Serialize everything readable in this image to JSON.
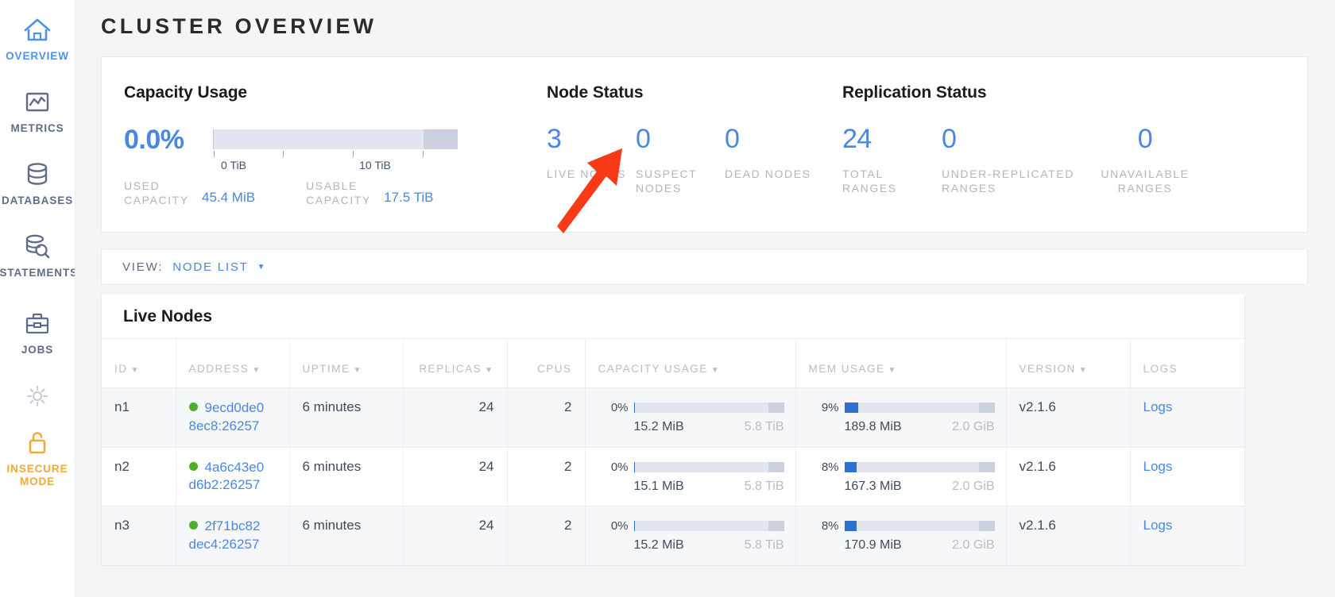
{
  "sidebar": {
    "items": [
      {
        "label": "OVERVIEW",
        "icon": "home-icon",
        "state": "active"
      },
      {
        "label": "METRICS",
        "icon": "chart-icon",
        "state": "normal"
      },
      {
        "label": "DATABASES",
        "icon": "database-icon",
        "state": "normal"
      },
      {
        "label": "STATEMENTS",
        "icon": "database-search-icon",
        "state": "normal"
      },
      {
        "label": "JOBS",
        "icon": "briefcase-icon",
        "state": "normal"
      },
      {
        "label": "",
        "icon": "gear-icon",
        "state": "normal"
      },
      {
        "label": "INSECURE MODE",
        "icon": "unlocked-padlock-icon",
        "state": "insecure"
      }
    ]
  },
  "page": {
    "title": "CLUSTER OVERVIEW"
  },
  "capacity": {
    "title": "Capacity Usage",
    "percent": "0.0%",
    "percent_value": 0.0,
    "ticks": [
      {
        "label": "0 TiB",
        "pos": 0
      },
      {
        "label": "",
        "pos": 28.6
      },
      {
        "label": "10 TiB",
        "pos": 57.1
      },
      {
        "label": "",
        "pos": 85.7
      }
    ],
    "used_label": "USED CAPACITY",
    "used_value": "45.4 MiB",
    "usable_label": "USABLE CAPACITY",
    "usable_value": "17.5 TiB"
  },
  "node_status": {
    "title": "Node Status",
    "stats": [
      {
        "value": "3",
        "label": "LIVE NODES"
      },
      {
        "value": "0",
        "label": "SUSPECT NODES"
      },
      {
        "value": "0",
        "label": "DEAD NODES"
      }
    ]
  },
  "replication_status": {
    "title": "Replication Status",
    "stats": [
      {
        "value": "24",
        "label": "TOTAL RANGES"
      },
      {
        "value": "0",
        "label": "UNDER-REPLICATED RANGES"
      },
      {
        "value": "0",
        "label": "UNAVAILABLE RANGES"
      }
    ]
  },
  "view_bar": {
    "label": "VIEW:",
    "value": "NODE LIST",
    "caret": "chevron-down-icon"
  },
  "table": {
    "title": "Live Nodes",
    "columns": [
      {
        "key": "id",
        "label": "ID",
        "sortable": true
      },
      {
        "key": "address",
        "label": "ADDRESS",
        "sortable": true
      },
      {
        "key": "uptime",
        "label": "UPTIME",
        "sortable": true
      },
      {
        "key": "replicas",
        "label": "REPLICAS",
        "sortable": true
      },
      {
        "key": "cpus",
        "label": "CPUS",
        "sortable": false
      },
      {
        "key": "capacity_usage",
        "label": "CAPACITY USAGE",
        "sortable": true
      },
      {
        "key": "mem_usage",
        "label": "MEM USAGE",
        "sortable": true
      },
      {
        "key": "version",
        "label": "VERSION",
        "sortable": true
      },
      {
        "key": "logs",
        "label": "LOGS",
        "sortable": false
      }
    ],
    "rows": [
      {
        "id": "n1",
        "address_line1": "9ecd0de0",
        "address_line2": "8ec8:26257",
        "status": "healthy",
        "uptime": "6 minutes",
        "replicas": "24",
        "cpus": "2",
        "capacity_pct": "0%",
        "capacity_pct_value": 0.26,
        "capacity_used": "15.2 MiB",
        "capacity_total": "5.8 TiB",
        "mem_pct": "9%",
        "mem_pct_value": 9,
        "mem_used": "189.8 MiB",
        "mem_total": "2.0 GiB",
        "version": "v2.1.6",
        "logs": "Logs"
      },
      {
        "id": "n2",
        "address_line1": "4a6c43e0",
        "address_line2": "d6b2:26257",
        "status": "healthy",
        "uptime": "6 minutes",
        "replicas": "24",
        "cpus": "2",
        "capacity_pct": "0%",
        "capacity_pct_value": 0.26,
        "capacity_used": "15.1 MiB",
        "capacity_total": "5.8 TiB",
        "mem_pct": "8%",
        "mem_pct_value": 8,
        "mem_used": "167.3 MiB",
        "mem_total": "2.0 GiB",
        "version": "v2.1.6",
        "logs": "Logs"
      },
      {
        "id": "n3",
        "address_line1": "2f71bc82",
        "address_line2": "dec4:26257",
        "status": "healthy",
        "uptime": "6 minutes",
        "replicas": "24",
        "cpus": "2",
        "capacity_pct": "0%",
        "capacity_pct_value": 0.26,
        "capacity_used": "15.2 MiB",
        "capacity_total": "5.8 TiB",
        "mem_pct": "8%",
        "mem_pct_value": 8,
        "mem_used": "170.9 MiB",
        "mem_total": "2.0 GiB",
        "version": "v2.1.6",
        "logs": "Logs"
      }
    ]
  },
  "annotation": {
    "type": "arrow",
    "color": "#f93a16",
    "points_to": "live-nodes-stat"
  },
  "colors": {
    "accent_blue": "#4a87e2",
    "healthy_green": "#4caf27",
    "insecure_orange": "#f2a93b",
    "muted_gray": "#b0b6c1",
    "bar_blue": "#2f6fd0",
    "arrow_red": "#f93a16"
  }
}
